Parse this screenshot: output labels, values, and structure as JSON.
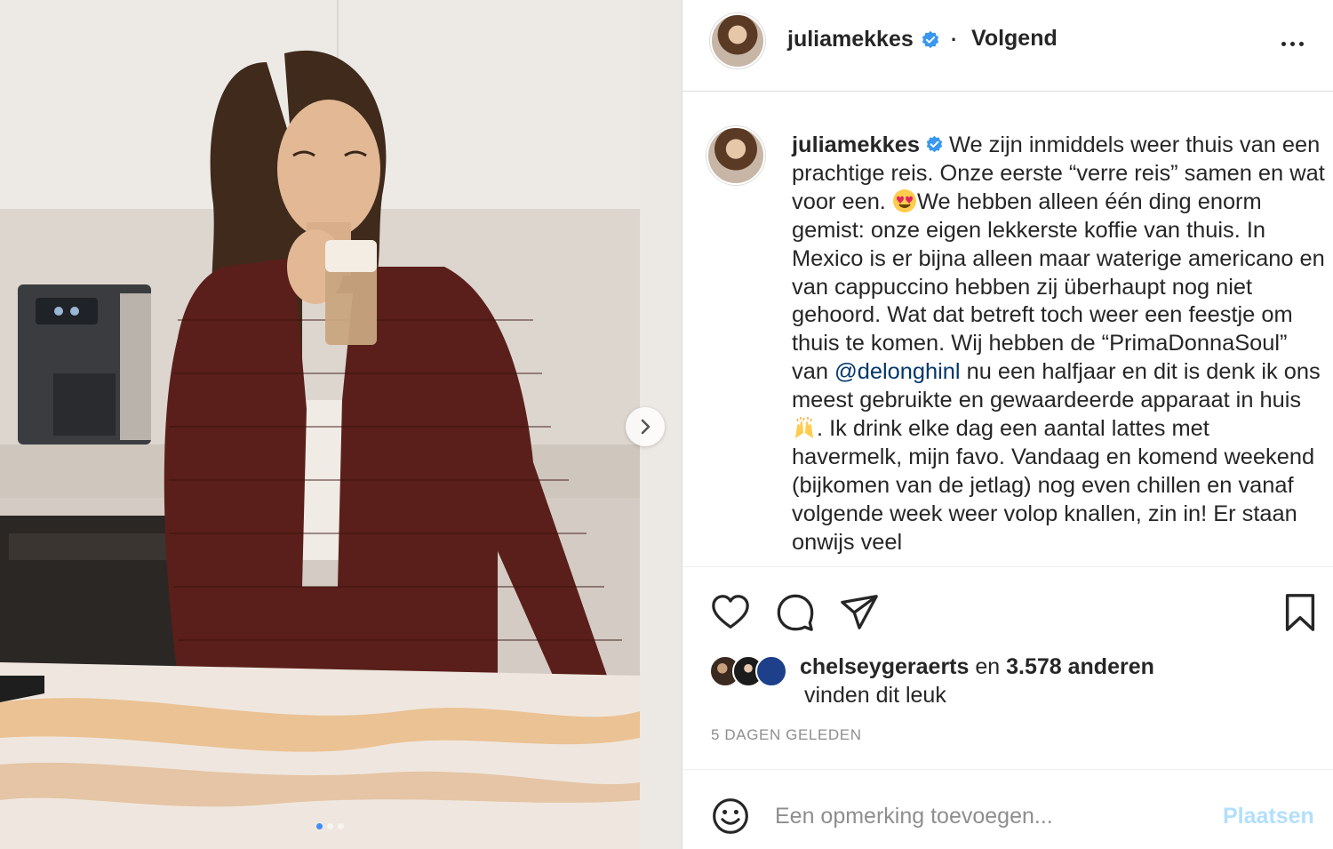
{
  "post": {
    "username": "juliamekkes",
    "separator": "·",
    "follow_status": "Volgend",
    "caption": {
      "seg1": "We zijn inmiddels weer thuis van een prachtige reis. Onze eerste “verre reis” samen en wat voor een.",
      "seg2": "We hebben alleen één ding enorm gemist: onze eigen lekkerste koffie van thuis. In Mexico is er bijna alleen maar waterige americano en van cappuccino hebben zij überhaupt nog niet gehoord. Wat dat betreft toch weer een feestje om thuis te komen. Wij hebben de “PrimaDonnaSoul” van ",
      "mention": "@delonghinl",
      "seg3": " nu een halfjaar en dit is denk ik ons meest gebruikte en gewaardeerde apparaat in huis",
      "seg4": ". Ik drink elke dag een aantal lattes met havermelk, mijn favo. Vandaag en komend weekend (bijkomen van de jetlag) nog even chillen en vanaf volgende week weer volop knallen, zin in! Er staan onwijs veel"
    },
    "emoji1": "heart-eyes-emoji",
    "emoji2": "raising-hands-emoji"
  },
  "likes": {
    "user": "chelseygeraerts",
    "connector": "en",
    "count": "3.578 anderen",
    "line2": "vinden dit leuk"
  },
  "timestamp": "5 DAGEN GELEDEN",
  "comment": {
    "placeholder": "Een opmerking toevoegen...",
    "post_label": "Plaatsen"
  },
  "carousel": {
    "total": 3,
    "active": 1
  },
  "colors": {
    "verified": "#3897f0",
    "mention": "#00376b",
    "post_disabled": "#b2dffc",
    "border": "#dbdbdb",
    "muted": "#8e8e8e"
  },
  "icons": [
    "heart-icon",
    "comment-icon",
    "share-icon",
    "bookmark-icon",
    "more-icon",
    "chevron-right-icon",
    "smiley-icon",
    "verified-badge-icon"
  ]
}
